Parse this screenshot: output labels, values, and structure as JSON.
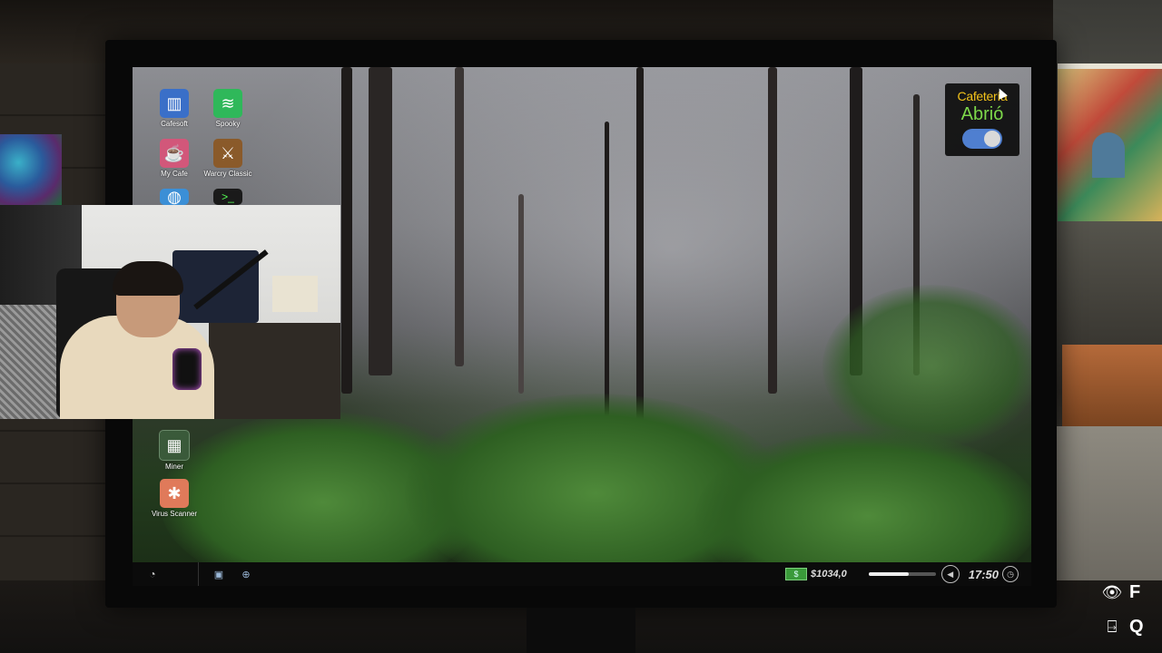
{
  "desktop": {
    "icons": [
      {
        "label": "Cafesoft",
        "icon": "cafesoft-icon",
        "color": "#3a6fc8"
      },
      {
        "label": "Spooky",
        "icon": "spooky-icon",
        "color": "#2fb85a"
      },
      {
        "label": "My Cafe",
        "icon": "mycafe-icon",
        "color": "#d2577a"
      },
      {
        "label": "Warcry Classic",
        "icon": "warcry-icon",
        "color": "#8a5a2a"
      },
      {
        "label": "",
        "icon": "browser-icon",
        "color": "#3b8fd6"
      },
      {
        "label": "",
        "icon": "terminal-icon",
        "color": "#1a1a1a"
      },
      {
        "label": "Miner",
        "icon": "miner-icon",
        "color": "#3a5a3a"
      },
      {
        "label": "Virus Scanner",
        "icon": "virus-scanner-icon",
        "color": "#e07a5a"
      }
    ]
  },
  "cafeteria_widget": {
    "title": "Cafetería",
    "status": "Abrió",
    "toggle_on": true,
    "title_color": "#f2c21a",
    "status_color": "#7dd84a"
  },
  "taskbar": {
    "money": "$1034,0",
    "volume_level": 0.6,
    "time": "17:50"
  },
  "key_hints": [
    {
      "icon": "eye-icon",
      "key": "F"
    },
    {
      "icon": "exit-door-icon",
      "key": "Q"
    }
  ]
}
